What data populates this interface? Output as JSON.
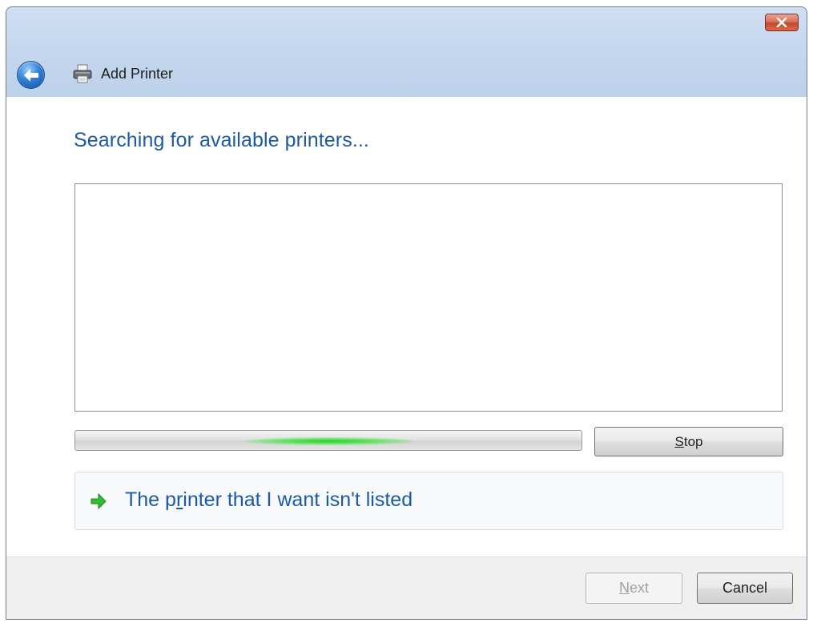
{
  "window": {
    "title": "Add Printer",
    "close_icon": "close-icon",
    "back_icon": "back-arrow-icon",
    "title_icon": "printer-icon"
  },
  "content": {
    "heading": "Searching for available printers...",
    "results": [],
    "progress": {
      "state": "indeterminate",
      "glow_position_fraction": 0.5
    },
    "stop_button": {
      "label": "Stop",
      "accel": "S",
      "rest": "top"
    },
    "not_listed_link": {
      "prefix": "The p",
      "accel": "r",
      "rest": "inter that I want isn't listed",
      "icon": "green-arrow-icon"
    }
  },
  "footer": {
    "next_button": {
      "accel": "N",
      "rest": "ext",
      "enabled": false
    },
    "cancel_button": {
      "label": "Cancel"
    }
  },
  "colors": {
    "heading": "#1d5aa6",
    "link": "#1d5aa6",
    "titlebar": "#c4d6ec",
    "progress_glow": "#27d12b",
    "close_button": "#c7452d"
  }
}
